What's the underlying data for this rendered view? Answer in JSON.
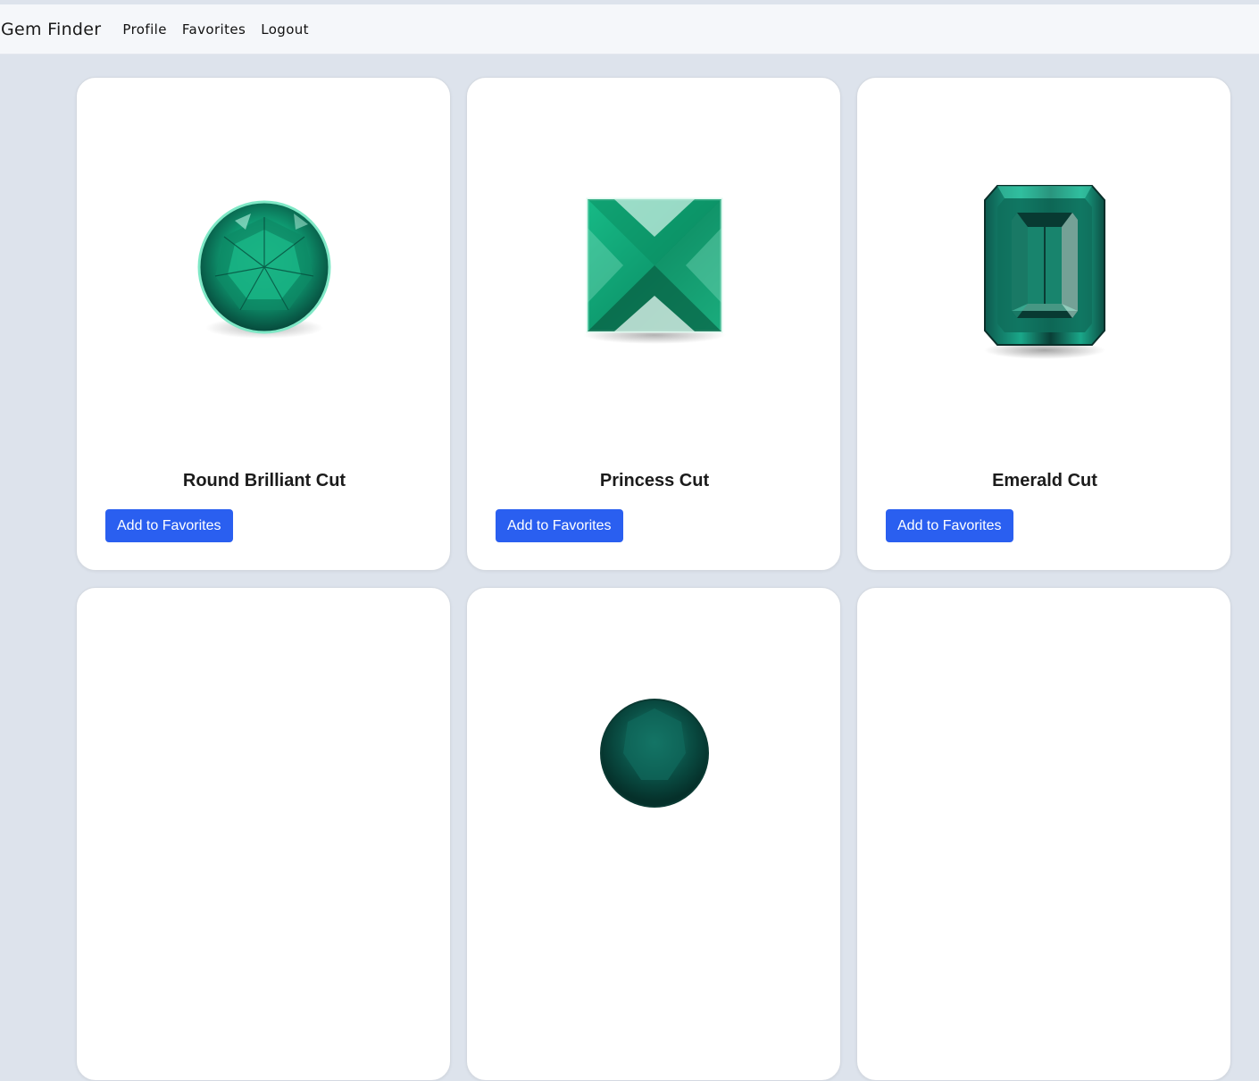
{
  "navbar": {
    "brand": "Gem Finder",
    "links": [
      "Profile",
      "Favorites",
      "Logout"
    ]
  },
  "cards": [
    {
      "title": "Round Brilliant Cut",
      "button": "Add to Favorites",
      "image": "round-gem-icon"
    },
    {
      "title": "Princess Cut",
      "button": "Add to Favorites",
      "image": "princess-gem-icon"
    },
    {
      "title": "Emerald Cut",
      "button": "Add to Favorites",
      "image": "emerald-gem-icon"
    },
    {
      "title": "",
      "button": "",
      "image": ""
    },
    {
      "title": "",
      "button": "",
      "image": "round-dark-gem-icon"
    },
    {
      "title": "",
      "button": "",
      "image": ""
    }
  ],
  "colors": {
    "accent": "#2a5ff0",
    "gem_green": "#14a37a",
    "background": "#dde3ec"
  }
}
